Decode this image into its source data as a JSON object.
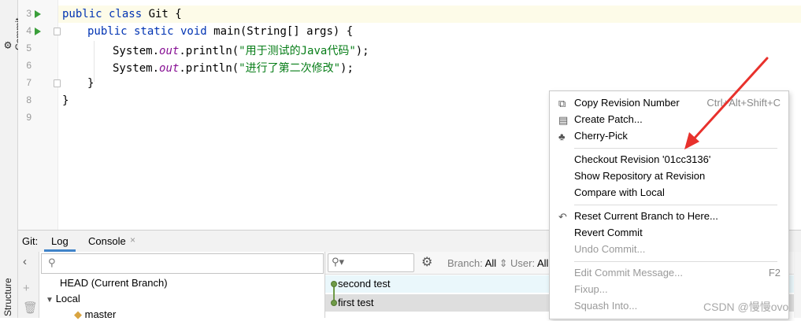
{
  "sidebar": {
    "commit_label": "Commit",
    "structure_label": "Structure"
  },
  "editor": {
    "line_numbers": [
      "3",
      "4",
      "5",
      "6",
      "7",
      "8",
      "9"
    ],
    "lines": {
      "l3_kw": "public class ",
      "l3_name": "Git {",
      "l4_kw": "public static void ",
      "l4_rest": "main(String[] args) {",
      "l5_a": "System.",
      "l5_it": "out",
      "l5_b": ".println(",
      "l5_str": "\"用于测试的Java代码\"",
      "l5_c": ");",
      "l6_a": "System.",
      "l6_it": "out",
      "l6_b": ".println(",
      "l6_str": "\"进行了第二次修改\"",
      "l6_c": ");",
      "l7": "}",
      "l8": "}"
    }
  },
  "bottom_panel": {
    "title": "Git:",
    "tabs": [
      {
        "label": "Log"
      },
      {
        "label": "Console"
      }
    ],
    "close_glyph": "×"
  },
  "branches": {
    "head": "HEAD (Current Branch)",
    "local": "Local",
    "master": "master"
  },
  "log": {
    "branch_filter_label": "Branch:",
    "branch_filter_value": "All",
    "user_filter_label": "User:",
    "user_filter_value": "All",
    "commits": [
      {
        "message": "second test"
      },
      {
        "message": "first test"
      }
    ]
  },
  "context_menu": {
    "copy_revision_number": "Copy Revision Number",
    "copy_revision_shortcut": "Ctrl+Alt+Shift+C",
    "create_patch": "Create Patch...",
    "cherry_pick": "Cherry-Pick",
    "checkout_revision": "Checkout Revision '01cc3136'",
    "show_repository": "Show Repository at Revision",
    "compare_with_local": "Compare with Local",
    "reset_branch": "Reset Current Branch to Here...",
    "revert_commit": "Revert Commit",
    "undo_commit": "Undo Commit...",
    "edit_commit_message": "Edit Commit Message...",
    "edit_commit_shortcut": "F2",
    "fixup": "Fixup...",
    "squash_into": "Squash Into..."
  },
  "watermark": "CSDN @慢慢ovo",
  "colors": {
    "arrow": "#e8312c",
    "keyword": "#0033b3",
    "string": "#067d17",
    "static_field": "#871094",
    "run_icon": "#3a9f3a",
    "tab_underline": "#4083c9"
  }
}
